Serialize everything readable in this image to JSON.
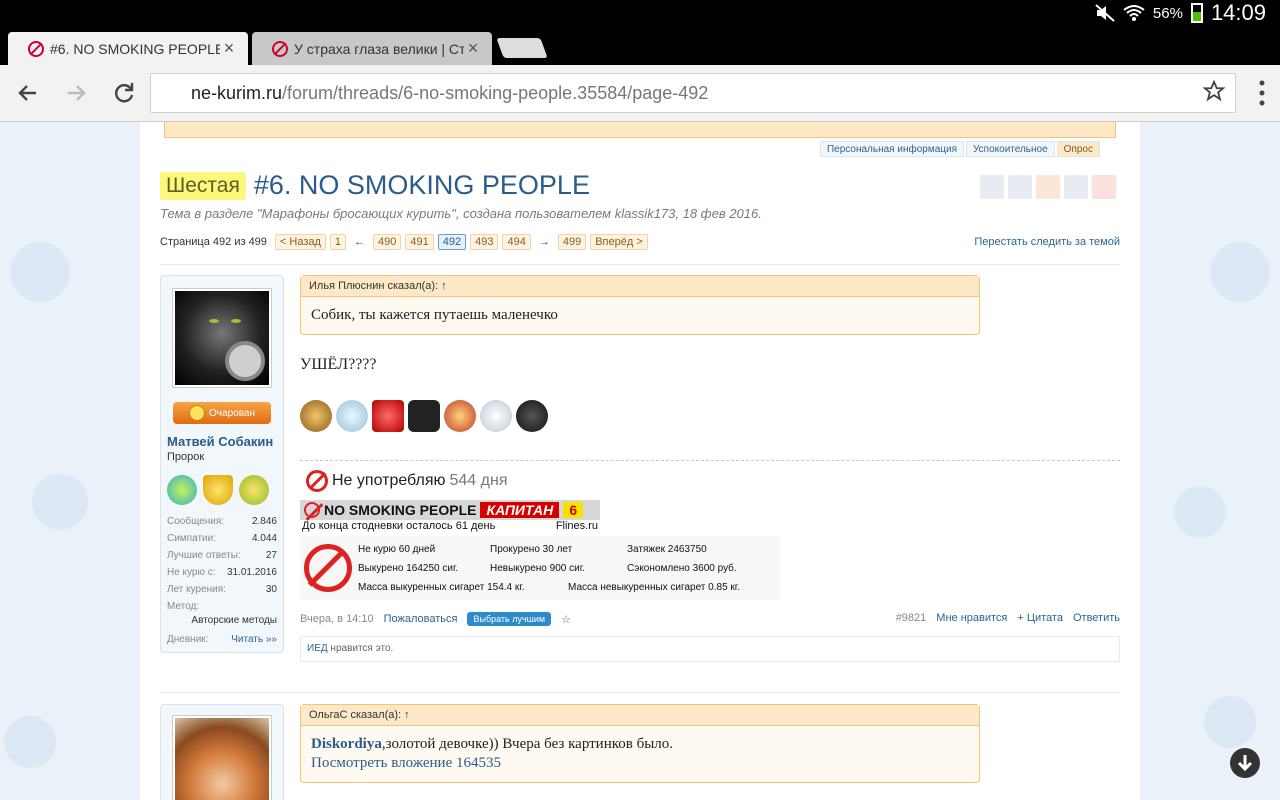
{
  "status": {
    "battery": "56%",
    "time": "14:09"
  },
  "tabs": [
    {
      "title": "#6. NO SMOKING PEOPLE | Стр",
      "close": "×"
    },
    {
      "title": "У страха глаза велики | Стр",
      "close": "×"
    }
  ],
  "address": {
    "domain": "ne-kurim.ru",
    "path": "/forum/threads/6-no-smoking-people.35584/page-492"
  },
  "icons": {
    "back": "back-arrow-icon",
    "forward": "forward-arrow-icon",
    "reload": "reload-icon",
    "star": "star-icon",
    "menu": "overflow-menu-icon",
    "scroll_down": "arrow-down-icon"
  },
  "subtabs": [
    "Персональная информация",
    "Успокоительное",
    "Опрос"
  ],
  "thread": {
    "prefix": "Шестая",
    "title": "#6. NO SMOKING PEOPLE",
    "meta": "Тема в разделе \"Марафоны бросающих курить\", создана пользователем klassik173, 18 фев 2016."
  },
  "pager": {
    "label": "Страница 492 из 499",
    "prev": "< Назад",
    "first": "1",
    "pages": [
      "490",
      "491",
      "492",
      "493",
      "494"
    ],
    "current": "492",
    "last": "499",
    "next": "Вперёд >",
    "left_arrow": "←",
    "right_arrow": "→",
    "unwatch": "Перестать следить за темой"
  },
  "post1": {
    "badge": "Очарован",
    "username": "Матвей Собакин",
    "user_title": "Пророк",
    "stats": [
      {
        "label": "Сообщения:",
        "value": "2.846"
      },
      {
        "label": "Симпатии:",
        "value": "4.044"
      },
      {
        "label": "Лучшие ответы:",
        "value": "27"
      },
      {
        "label": "Не курю с:",
        "value": "31.01.2016"
      },
      {
        "label": "Лет курения:",
        "value": "30"
      }
    ],
    "method_label": "Метод:",
    "method_value": "Авторские методы",
    "diary_label": "Дневник:",
    "diary_link": "Читать »»",
    "quote_head": "Илья Плюснин сказал(а): ↑",
    "quote_body": "Собик, ты кажется путаешь маленечко",
    "text": "УШЁЛ????",
    "nosmoke_text": "Не употребляю",
    "nosmoke_days": "544 дня",
    "banner_title": "NO SMOKING PEOPLE",
    "banner_rank": "КАПИТАН",
    "banner_num": "6",
    "banner_sub_left": "До конца стодневки осталось 61 день",
    "banner_sub_right": "Flines.ru",
    "counter": {
      "r1c1": "Не курю 60 дней",
      "r1c2": "Прокурено 30 лет",
      "r1c3": "Затяжек 2463750",
      "r2c1": "Выкурено 164250 сиг.",
      "r2c2": "Невыкурено 900 сиг.",
      "r2c3": "Сэкономлено 3600 руб.",
      "r3c1": "Масса выкуренных сигарет 154.4 кг.",
      "r3c2": "Масса невыкуренных сигарет 0.85 кг."
    },
    "date": "Вчера, в 14:10",
    "report": "Пожаловаться",
    "best": "Выбрать лучшим",
    "star": "☆",
    "number": "#9821",
    "like": "Мне нравится",
    "quote": "+ Цитата",
    "reply": "Ответить",
    "likes_user": "ИЕД",
    "likes_text": " нравится это."
  },
  "post2": {
    "quote_head": "ОльгаС сказал(а): ↑",
    "quote_author": "Diskordiya",
    "quote_text": ",золотой девочке)) Вчера без картинков было.",
    "attachment": "Посмотреть вложение 164535"
  }
}
